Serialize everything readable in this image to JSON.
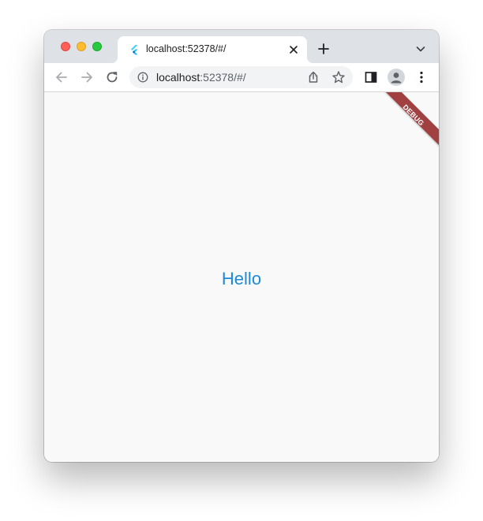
{
  "tab": {
    "title": "localhost:52378/#/"
  },
  "toolbar": {
    "url_host": "localhost",
    "url_rest": ":52378/#/"
  },
  "content": {
    "text": "Hello",
    "debug_banner": "DEBUG"
  },
  "colors": {
    "tabstrip": "#dee1e6",
    "accent_text": "#1c8ad8",
    "debug_banner": "#a14040",
    "page_background": "#f9f9f9"
  },
  "icons": {
    "favicon": "flutter-icon",
    "close": "close-icon",
    "new_tab": "plus-icon",
    "tab_search": "chevron-down-icon",
    "back": "arrow-left-icon",
    "forward": "arrow-right-icon",
    "reload": "reload-icon",
    "site_info": "info-icon",
    "share": "share-icon",
    "bookmark": "star-icon",
    "side_panel": "side-panel-icon",
    "profile": "avatar-icon",
    "menu": "kebab-menu-icon"
  }
}
